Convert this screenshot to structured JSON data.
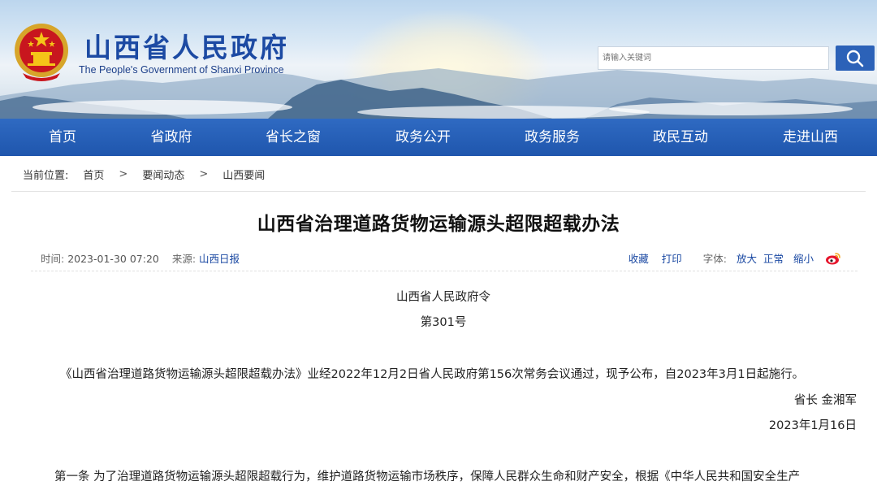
{
  "header": {
    "site_title": "山西省人民政府",
    "site_subtitle": "The People's Government of Shanxi Province",
    "search": {
      "placeholder": "请输入关键词"
    },
    "emblem": "national-emblem",
    "colors": {
      "brand": "#1c4aa3",
      "nav": "#2863ba",
      "search_button": "#2c62b8"
    }
  },
  "nav": {
    "items": [
      {
        "label": "首页"
      },
      {
        "label": "省政府"
      },
      {
        "label": "省长之窗"
      },
      {
        "label": "政务公开"
      },
      {
        "label": "政务服务"
      },
      {
        "label": "政民互动"
      },
      {
        "label": "走进山西"
      }
    ]
  },
  "breadcrumb": {
    "prefix": "当前位置:",
    "items": [
      "首页",
      "要闻动态",
      "山西要闻"
    ],
    "separator": ">"
  },
  "article": {
    "title": "山西省治理道路货物运输源头超限超载办法",
    "meta": {
      "time_label": "时间:",
      "time": "2023-01-30 07:20",
      "source_label": "来源:",
      "source": "山西日报",
      "favorite": "收藏",
      "print": "打印",
      "font_label": "字体:",
      "font_large": "放大",
      "font_normal": "正常",
      "font_small": "缩小",
      "share_icon": "weibo-icon"
    },
    "decree_issuer": "山西省人民政府令",
    "decree_number": "第301号",
    "decree_paragraph": "《山西省治理道路货物运输源头超限超载办法》业经2022年12月2日省人民政府第156次常务会议通过，现予公布，自2023年3月1日起施行。",
    "signature": "省长 金湘军",
    "date": "2023年1月16日",
    "first_article": "第一条 为了治理道路货物运输源头超限超载行为，维护道路货物运输市场秩序，保障人民群众生命和财产安全，根据《中华人民共和国安全生产"
  }
}
